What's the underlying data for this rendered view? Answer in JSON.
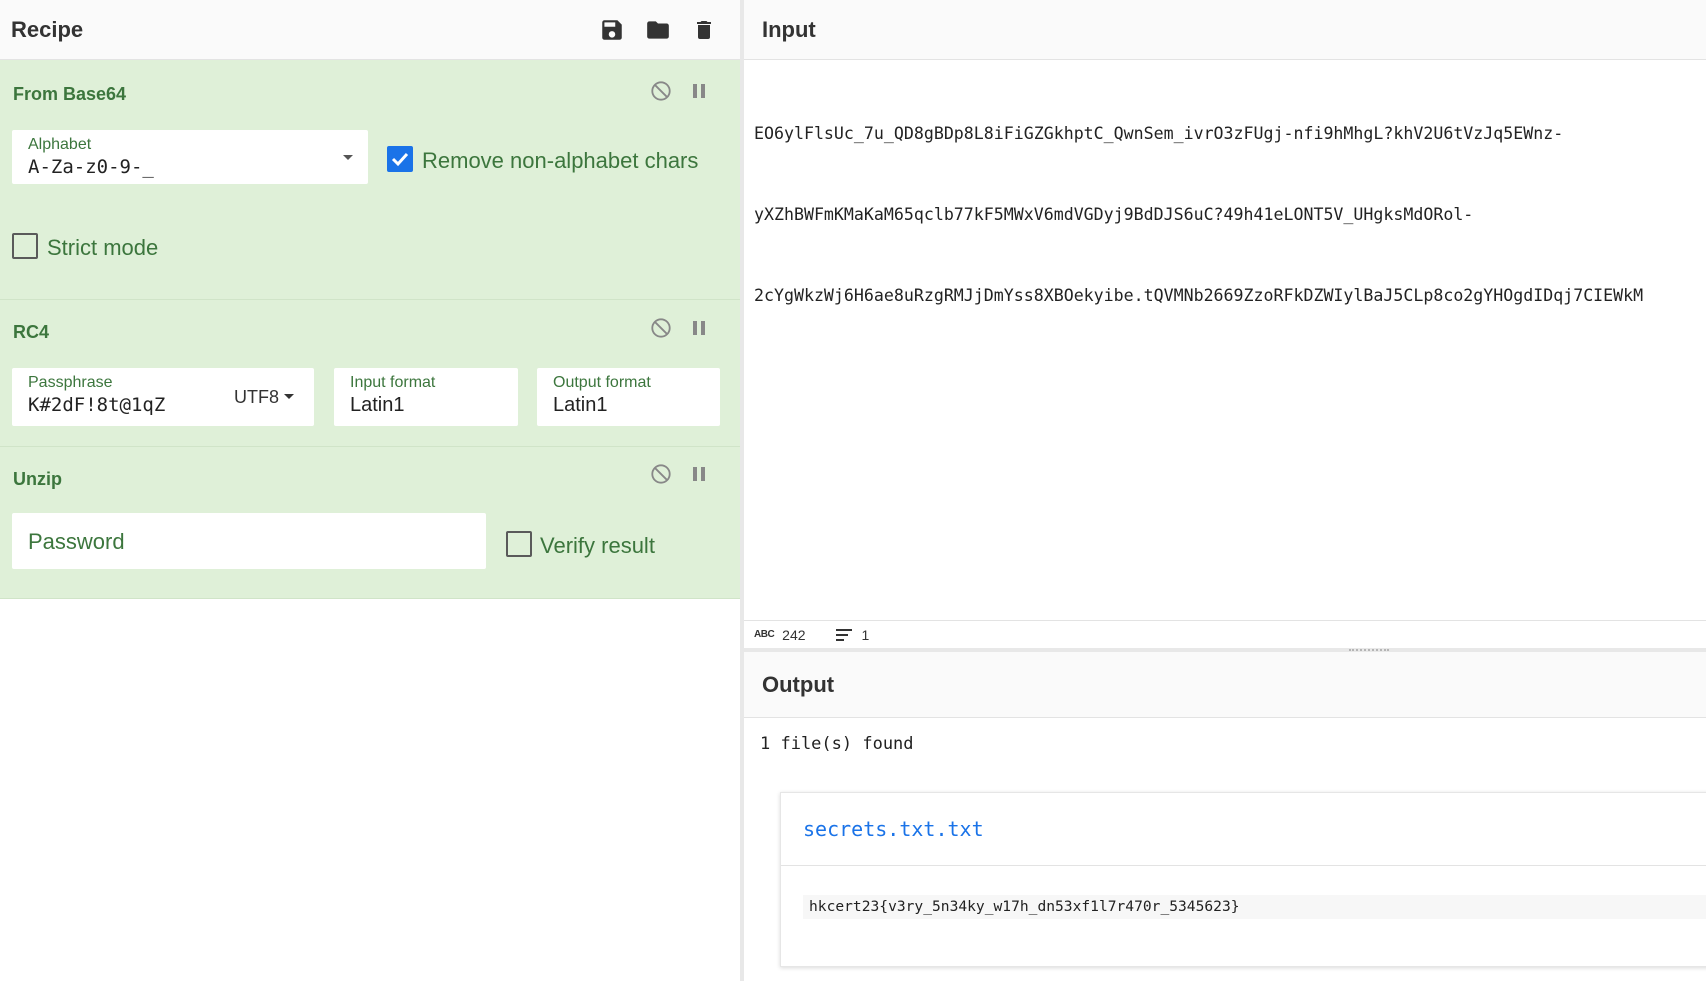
{
  "recipe": {
    "title": "Recipe",
    "toolbar": {
      "save_icon": "save-icon",
      "load_icon": "folder-icon",
      "clear_icon": "trash-icon"
    },
    "operations": [
      {
        "name": "From Base64",
        "alphabet_label": "Alphabet",
        "alphabet_value": "A-Za-z0-9-_",
        "remove_non_alpha_label": "Remove non-alphabet chars",
        "remove_non_alpha_checked": true,
        "strict_mode_label": "Strict mode",
        "strict_mode_checked": false
      },
      {
        "name": "RC4",
        "passphrase_label": "Passphrase",
        "passphrase_value": "K#2dF!8t@1qZ",
        "passphrase_encoding": "UTF8",
        "input_format_label": "Input format",
        "input_format_value": "Latin1",
        "output_format_label": "Output format",
        "output_format_value": "Latin1"
      },
      {
        "name": "Unzip",
        "password_placeholder": "Password",
        "verify_label": "Verify result",
        "verify_checked": false
      }
    ]
  },
  "input": {
    "title": "Input",
    "lines": [
      "EO6ylFlsUc_7u_QD8gBDp8L8iFiGZGkhptC_QwnSem_ivrO3zFUgj-nfi9hMhgL?khV2U6tVzJq5EWnz-",
      "yXZhBWFmKMaKaM65qclb77kF5MWxV6mdVGDyj9BdDJS6uC?49h41eLONT5V_UHgksMdORol-",
      "2cYgWkzWj6H6ae8uRzgRMJjDmYss8XBOekyibe.tQVMNb2669ZzoRFkDZWIylBaJ5CLp8co2gYHOgdIDqj7CIEWkM"
    ],
    "char_count": "242",
    "line_count": "1"
  },
  "output": {
    "title": "Output",
    "summary": "1 file(s) found",
    "file_name": "secrets.txt.txt",
    "file_content": "hkcert23{v3ry_5n34ky_w17h_dn53xf1l7r470r_5345623}"
  },
  "colors": {
    "op_bg": "#dff0d8",
    "op_text": "#3c763d",
    "link": "#1a73e8"
  }
}
